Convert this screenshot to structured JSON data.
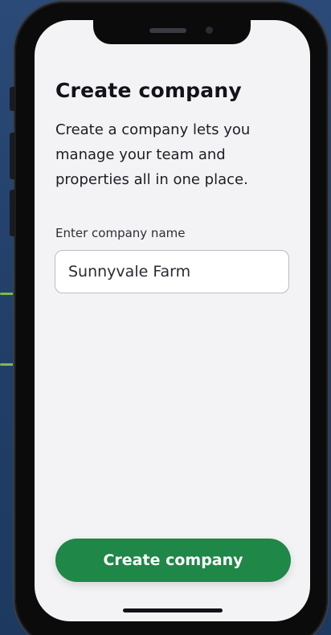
{
  "screen": {
    "title": "Create company",
    "description": "Create a company lets you manage your team and properties all in one place.",
    "company_name_field": {
      "label": "Enter company name",
      "value": "Sunnyvale Farm"
    },
    "create_button_label": "Create company"
  },
  "colors": {
    "accent": "#1f8747",
    "background": "#22406a",
    "screen": "#f3f3f5"
  }
}
